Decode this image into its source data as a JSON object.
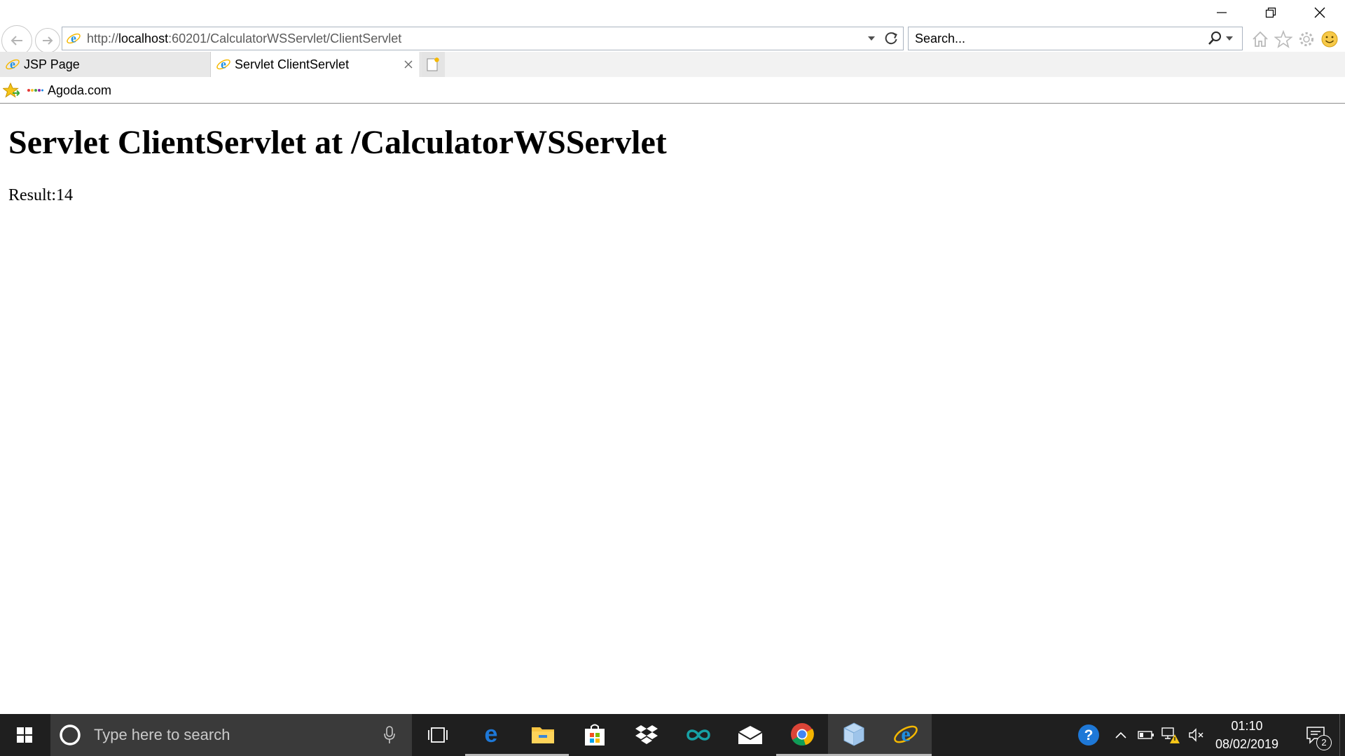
{
  "window": {
    "minimize_icon": "minimize-icon",
    "restore_icon": "restore-icon",
    "close_icon": "close-icon"
  },
  "navigation": {
    "back_icon": "back-arrow-icon",
    "forward_icon": "forward-arrow-icon"
  },
  "address_bar": {
    "url_prefix": "http://",
    "url_host": "localhost",
    "url_rest": ":60201/CalculatorWSServlet/ClientServlet",
    "site_icon": "internet-explorer-icon",
    "dropdown_icon": "chevron-down-icon",
    "refresh_icon": "refresh-icon"
  },
  "search_bar": {
    "placeholder": "Search...",
    "search_icon": "search-icon",
    "dropdown_icon": "chevron-down-icon"
  },
  "toolbar_icons": [
    "home-icon",
    "favorites-star-icon",
    "gear-icon",
    "smiley-feedback-icon"
  ],
  "tabs": [
    {
      "label": "JSP Page",
      "active": false
    },
    {
      "label": "Servlet ClientServlet",
      "active": true
    }
  ],
  "favorites_bar": {
    "items": [
      {
        "label": "Agoda.com"
      }
    ]
  },
  "page": {
    "heading": "Servlet ClientServlet at /CalculatorWSServlet",
    "result": "Result:14"
  },
  "taskbar": {
    "search_placeholder": "Type here to search",
    "apps": [
      "task-view-icon",
      "edge-icon",
      "file-explorer-icon",
      "store-icon",
      "dropbox-icon",
      "arduino-icon",
      "mail-icon",
      "chrome-icon",
      "virtualbox-icon",
      "internet-explorer-icon"
    ],
    "tray_icons": [
      "help-icon",
      "chevron-up-icon",
      "battery-icon",
      "network-warning-icon",
      "volume-muted-icon"
    ],
    "clock": {
      "time": "01:10",
      "date": "08/02/2019"
    },
    "notification_count": "2"
  },
  "colors": {
    "taskbar_bg": "#1f1f1f",
    "taskbar_search_bg": "#3a3a3a",
    "ie_blue": "#1e8fe1",
    "ie_ring": "#f5b800"
  }
}
